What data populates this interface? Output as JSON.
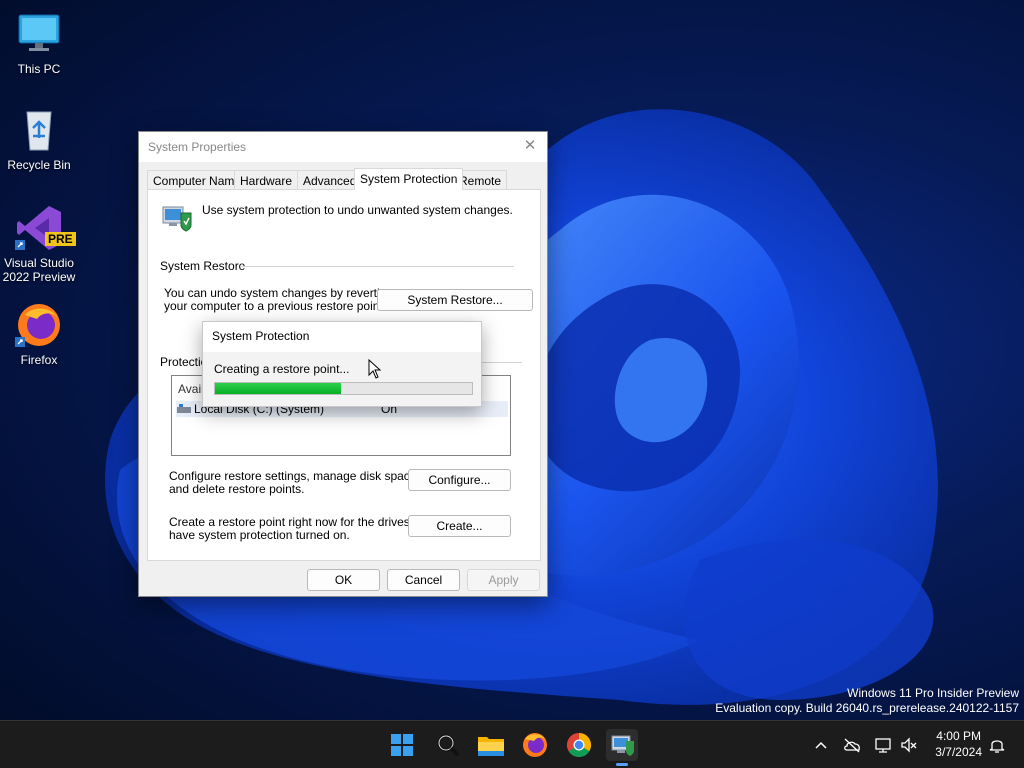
{
  "desktop": {
    "icons": [
      {
        "label": "This PC",
        "icon": "monitor-icon"
      },
      {
        "label": "Recycle Bin",
        "icon": "recycle-bin-icon"
      },
      {
        "label_line1": "Visual Studio",
        "label_line2": "2022 Preview",
        "badge": "PRE",
        "icon": "visual-studio-icon"
      },
      {
        "label": "Firefox",
        "icon": "firefox-icon"
      }
    ]
  },
  "dialog": {
    "title": "System Properties",
    "close_glyph": "✕",
    "tabs": [
      "Computer Name",
      "Hardware",
      "Advanced",
      "System Protection",
      "Remote"
    ],
    "active_tab": "System Protection",
    "intro_text": "Use system protection to undo unwanted system changes.",
    "restore_group_label": "System Restore",
    "restore_text_line1": "You can undo system changes by reverting",
    "restore_text_line2": "your computer to a previous restore point.",
    "restore_button": "System Restore...",
    "protection_group_label": "Protection",
    "list_header": "Availa",
    "drive_name": "Local Disk (C:) (System)",
    "drive_status": "On",
    "configure_text_line1": "Configure restore settings, manage disk space,",
    "configure_text_line2": "and delete restore points.",
    "configure_button": "Configure...",
    "create_text_line1": "Create a restore point right now for the drives that",
    "create_text_line2": "have system protection turned on.",
    "create_button": "Create...",
    "ok_button": "OK",
    "cancel_button": "Cancel",
    "apply_button": "Apply"
  },
  "progress_popup": {
    "title": "System Protection",
    "message": "Creating a restore point...",
    "progress_fraction": 0.49,
    "bar_color": "#06b025"
  },
  "watermark": {
    "line1": "Windows 11 Pro Insider Preview",
    "line2": "Evaluation copy. Build 26040.rs_prerelease.240122-1157"
  },
  "taskbar": {
    "apps": [
      "start-icon",
      "search-icon",
      "file-explorer-icon",
      "firefox-icon",
      "chrome-icon",
      "system-properties-icon"
    ],
    "time": "4:00 PM",
    "date": "3/7/2024",
    "tray_icons": [
      "chevron-up-icon",
      "cloud-offline-icon",
      "network-icon",
      "volume-muted-icon",
      "notification-bell-icon"
    ]
  }
}
